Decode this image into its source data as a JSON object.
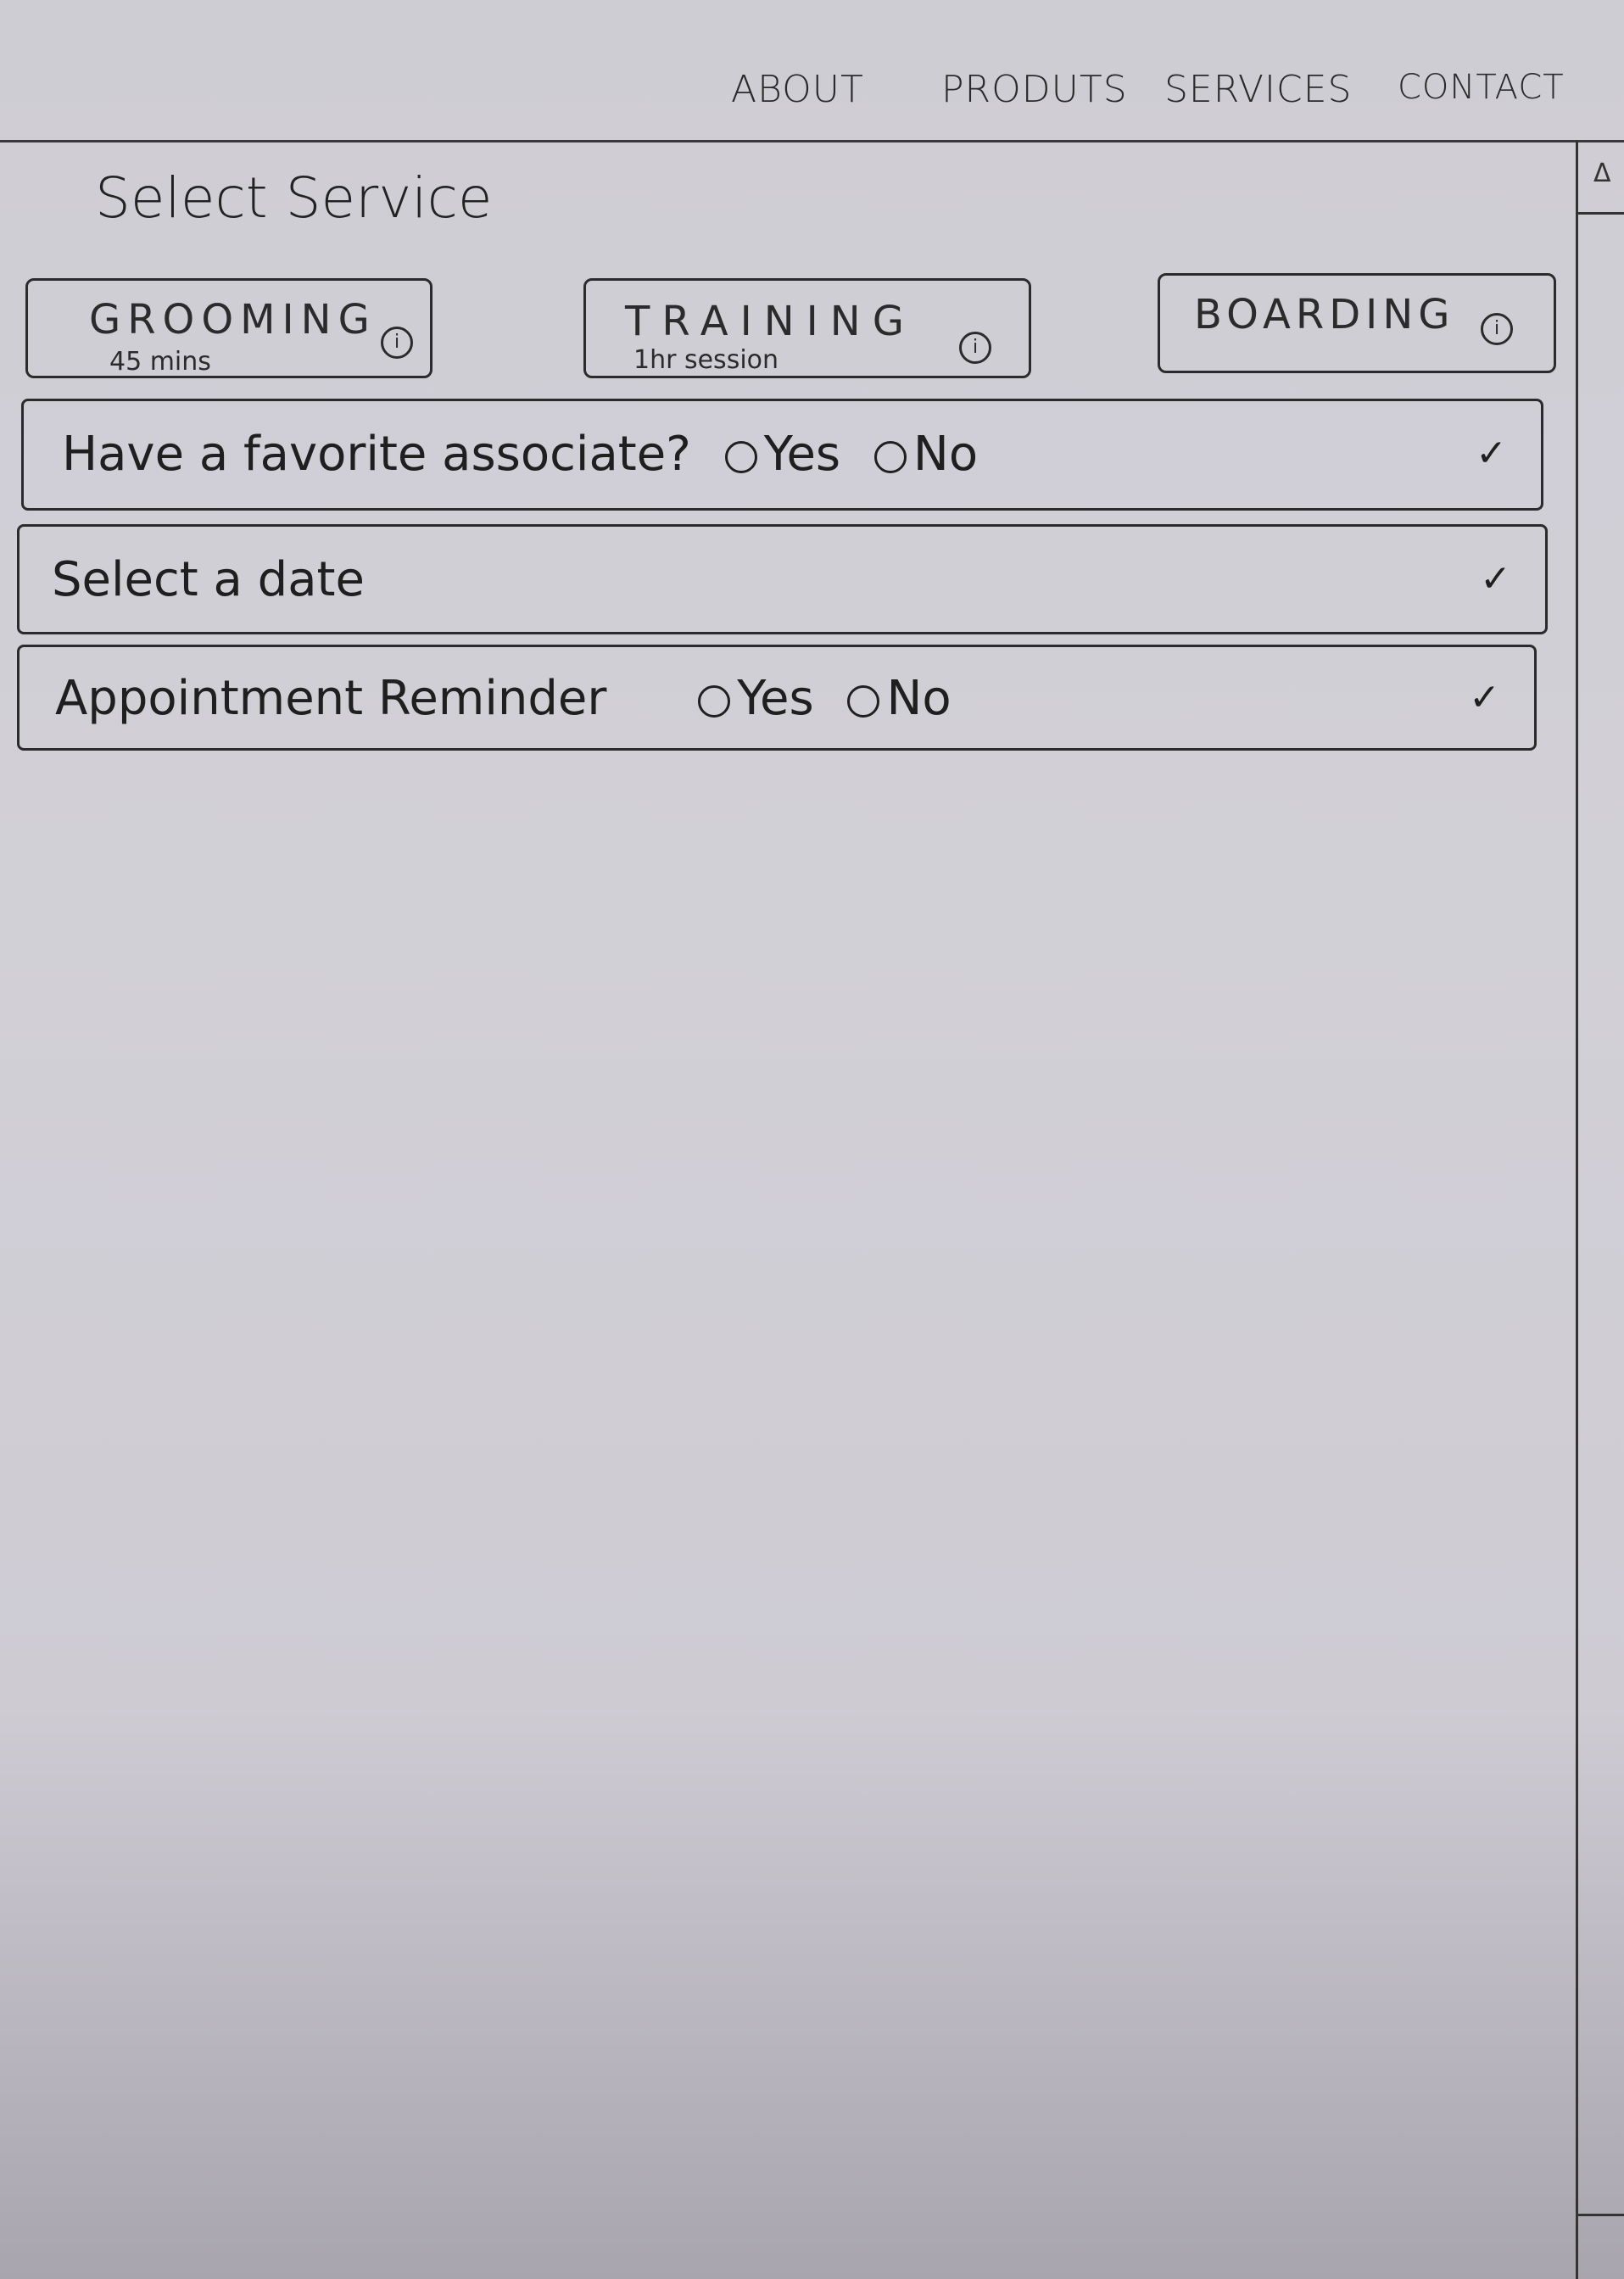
{
  "nav": {
    "items": [
      "ABOUT",
      "PRODUTS",
      "SERVICES",
      "CONTACT"
    ]
  },
  "scrollbar": {
    "up_glyph": "Δ"
  },
  "page_title": "Select Service",
  "services": [
    {
      "name": "GROOMING",
      "detail": "45 mins",
      "info_glyph": "i"
    },
    {
      "name": "TRAINING",
      "detail": "1hr session",
      "info_glyph": "i"
    },
    {
      "name": "BOARDING",
      "detail": "",
      "info_glyph": "i"
    }
  ],
  "accordions": [
    {
      "label": "Have a favorite associate?",
      "options": [
        "Yes",
        "No"
      ],
      "chevron": "✓"
    },
    {
      "label": "Select a date",
      "options": [],
      "chevron": "✓"
    },
    {
      "label": "Appointment Reminder",
      "options": [
        "Yes",
        "No"
      ],
      "chevron": "✓"
    }
  ],
  "icons": {
    "chevron": "chevron-down-icon",
    "info": "info-icon",
    "scroll_up": "scroll-up-arrow-icon"
  },
  "colors": {
    "ink": "#2b2b2b",
    "paper": "#d0ced5"
  }
}
